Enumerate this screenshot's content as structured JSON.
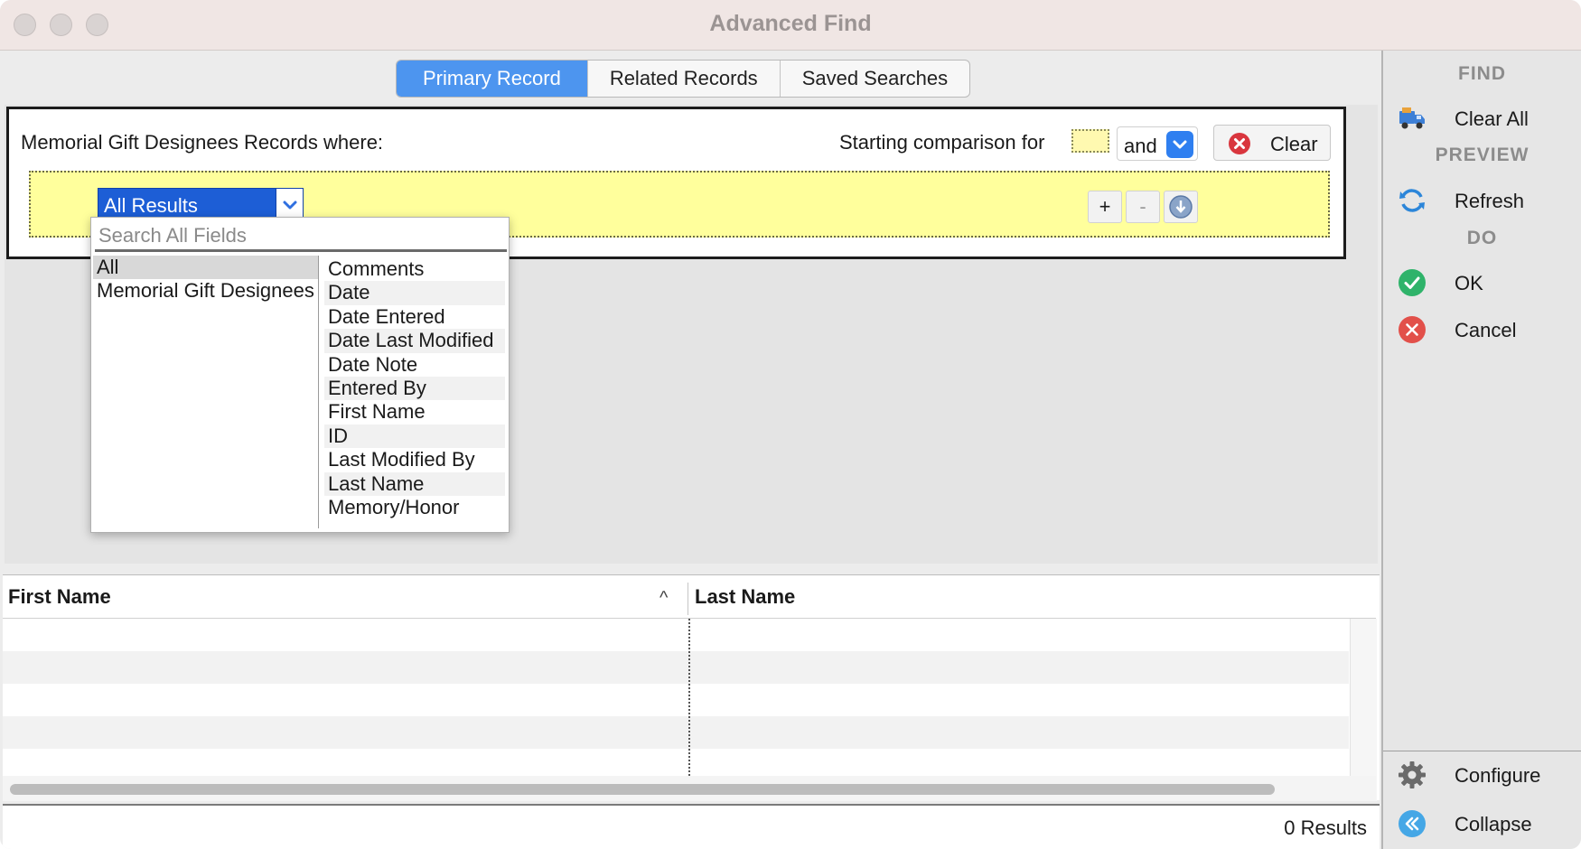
{
  "window": {
    "title": "Advanced Find"
  },
  "tabs": [
    {
      "label": "Primary Record",
      "active": true
    },
    {
      "label": "Related Records",
      "active": false
    },
    {
      "label": "Saved Searches",
      "active": false
    }
  ],
  "criteria": {
    "title": "Memorial Gift Designees Records where:",
    "starting_label": "Starting comparison for",
    "conjunction": "and",
    "clear_label": "Clear",
    "rule_field": "All Results",
    "add_label": "+",
    "remove_label": "-"
  },
  "field_popup": {
    "search_placeholder": "Search All Fields",
    "categories": [
      "All",
      "Memorial Gift Designees"
    ],
    "selected_category": "All",
    "fields": [
      "Comments",
      "Date",
      "Date Entered",
      "Date Last Modified",
      "Date Note",
      "Entered By",
      "First Name",
      "ID",
      "Last Modified By",
      "Last Name",
      "Memory/Honor"
    ]
  },
  "results": {
    "columns": [
      "First Name",
      "Last Name"
    ],
    "sort_indicator": "^",
    "status": "0 Results"
  },
  "sidebar": {
    "find_heading": "FIND",
    "clear_all_label": "Clear All",
    "preview_heading": "PREVIEW",
    "refresh_label": "Refresh",
    "do_heading": "DO",
    "ok_label": "OK",
    "cancel_label": "Cancel",
    "configure_label": "Configure",
    "collapse_label": "Collapse"
  },
  "colors": {
    "accent": "#4d95ef",
    "rule_highlight": "#ffff9c",
    "ok": "#2fb36a",
    "cancel": "#e2504a"
  },
  "icons": [
    "truck-icon",
    "refresh-icon",
    "checkmark-icon",
    "cancel-icon",
    "gear-icon",
    "collapse-icon",
    "clear-x-icon",
    "chevron-down-icon",
    "info-down-icon"
  ]
}
